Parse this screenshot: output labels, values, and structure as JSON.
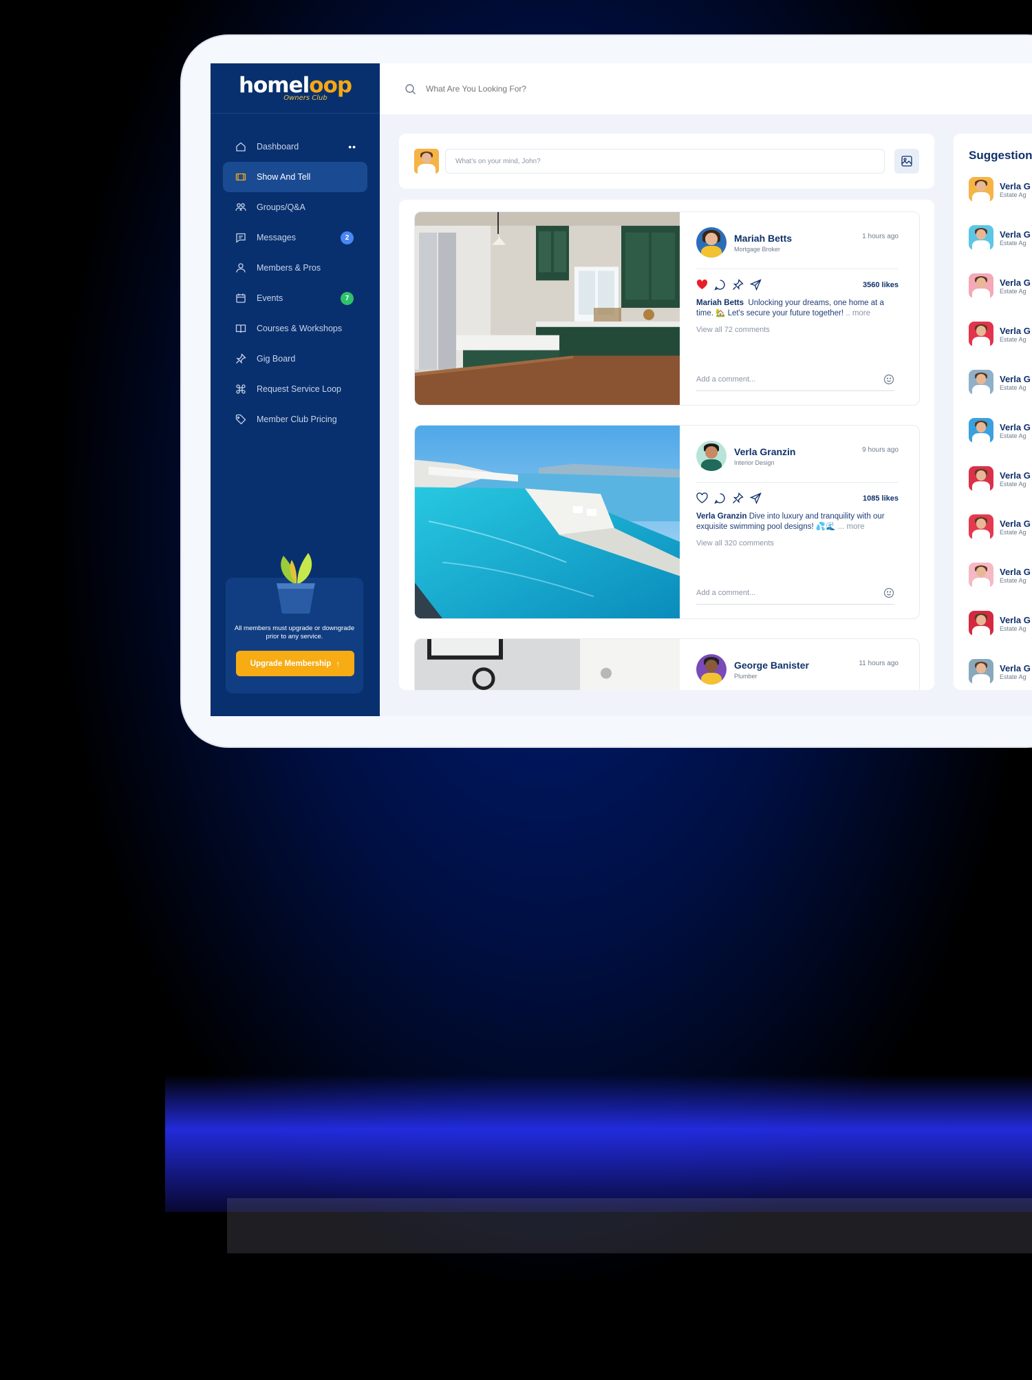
{
  "brand": {
    "logo_main": "homel",
    "logo_accent": "oop",
    "logo_sub": "Owners Club"
  },
  "search": {
    "placeholder": "What Are You Looking For?"
  },
  "sidebar": {
    "items": [
      {
        "label": "Dashboard",
        "icon": "home-icon"
      },
      {
        "label": "Show And Tell",
        "icon": "film-icon",
        "active": true
      },
      {
        "label": "Groups/Q&A",
        "icon": "people-icon"
      },
      {
        "label": "Messages",
        "icon": "chat-icon",
        "badge": "2"
      },
      {
        "label": "Members & Pros",
        "icon": "user-icon"
      },
      {
        "label": "Events",
        "icon": "calendar-icon",
        "badge": "7"
      },
      {
        "label": "Courses & Workshops",
        "icon": "book-icon"
      },
      {
        "label": "Gig Board",
        "icon": "pin-icon"
      },
      {
        "label": "Request Service Loop",
        "icon": "command-icon"
      },
      {
        "label": "Member Club Pricing",
        "icon": "tag-icon"
      }
    ],
    "dashboard_dots": "••",
    "upgrade_text": "All members must upgrade or downgrade prior to any service.",
    "upgrade_button": "Upgrade Membership"
  },
  "composer": {
    "placeholder": "What's on your mind, John?"
  },
  "posts": [
    {
      "name": "Mariah Betts",
      "role": "Mortgage Broker",
      "time": "1 hours ago",
      "likes": "3560 likes",
      "caption_author": "Mariah Betts",
      "caption": "Unlocking your dreams, one home at a time. 🏡 Let's secure your future together!",
      "more": ".. more",
      "view_all": "View all 72 comments",
      "comment_placeholder": "Add a comment..."
    },
    {
      "name": "Verla Granzin",
      "role": "Interior Design",
      "time": "9 hours ago",
      "likes": "1085 likes",
      "caption_author": "Verla Granzin",
      "caption": "Dive into luxury and tranquility with our exquisite swimming pool designs! 💦🌊",
      "more": "... more",
      "view_all": "View all 320 comments",
      "comment_placeholder": "Add a comment..."
    },
    {
      "name": "George Banister",
      "role": "Plumber",
      "time": "11 hours ago"
    }
  ],
  "suggestions": {
    "title": "Suggestions",
    "items": [
      {
        "name": "Verla G",
        "role": "Estate Ag",
        "color": "#f6b446"
      },
      {
        "name": "Verla G",
        "role": "Estate Ag",
        "color": "#5cc6e4"
      },
      {
        "name": "Verla G",
        "role": "Estate Ag",
        "color": "#f4a8b8"
      },
      {
        "name": "Verla G",
        "role": "Estate Ag",
        "color": "#e2344c"
      },
      {
        "name": "Verla G",
        "role": "Estate Ag",
        "color": "#8fb0c8"
      },
      {
        "name": "Verla G",
        "role": "Estate Ag",
        "color": "#3aa0e0"
      },
      {
        "name": "Verla G",
        "role": "Estate Ag",
        "color": "#d8324a"
      },
      {
        "name": "Verla G",
        "role": "Estate Ag",
        "color": "#e23a4e"
      },
      {
        "name": "Verla G",
        "role": "Estate Ag",
        "color": "#f6b8c4"
      },
      {
        "name": "Verla G",
        "role": "Estate Ag",
        "color": "#d42a40"
      },
      {
        "name": "Verla G",
        "role": "Estate Ag",
        "color": "#88a8bc"
      }
    ]
  },
  "colors": {
    "sidebar": "#08306e",
    "accent": "#f7ac14",
    "brand_blue": "#10316a",
    "like_red": "#e8202a"
  }
}
